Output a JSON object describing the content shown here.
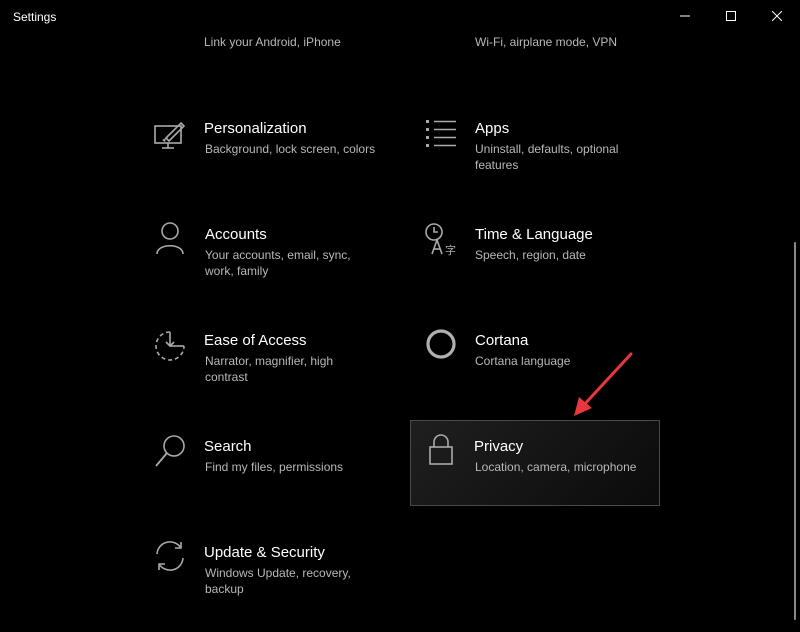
{
  "window": {
    "title": "Settings",
    "minimize_icon": "minimize-icon",
    "maximize_icon": "maximize-icon",
    "close_icon": "close-icon"
  },
  "colors": {
    "background": "#000000",
    "description": "#b8b8b8",
    "icon": "#aaaaaa",
    "selected_border": "#4a4a4a",
    "annotation_arrow": "#e8383d"
  },
  "partial_tiles": {
    "phone": {
      "icon": "phone-icon",
      "description": "Link your Android, iPhone"
    },
    "network": {
      "icon": "globe-icon",
      "description": "Wi-Fi, airplane mode, VPN"
    }
  },
  "tiles": {
    "personalization": {
      "icon": "paint-monitor-icon",
      "name": "Personalization",
      "desc1": "Background, lock screen, colors",
      "desc2": ""
    },
    "apps": {
      "icon": "apps-list-icon",
      "name": "Apps",
      "desc1": "Uninstall, defaults, optional",
      "desc2": "features"
    },
    "accounts": {
      "icon": "person-icon",
      "name": "Accounts",
      "desc1": "Your accounts, email, sync,",
      "desc2": "work, family"
    },
    "time_language": {
      "icon": "clock-language-icon",
      "name": "Time & Language",
      "desc1": "Speech, region, date",
      "desc2": ""
    },
    "ease_of_access": {
      "icon": "ease-of-access-icon",
      "name": "Ease of Access",
      "desc1": "Narrator, magnifier, high",
      "desc2": "contrast"
    },
    "cortana": {
      "icon": "cortana-icon",
      "name": "Cortana",
      "desc1": "Cortana language",
      "desc2": ""
    },
    "search": {
      "icon": "search-icon",
      "name": "Search",
      "desc1": "Find my files, permissions",
      "desc2": ""
    },
    "privacy": {
      "icon": "lock-icon",
      "name": "Privacy",
      "desc1": "Location, camera, microphone",
      "desc2": "",
      "selected": true
    },
    "update_security": {
      "icon": "refresh-icon",
      "name": "Update & Security",
      "desc1": "Windows Update, recovery,",
      "desc2": "backup"
    }
  }
}
